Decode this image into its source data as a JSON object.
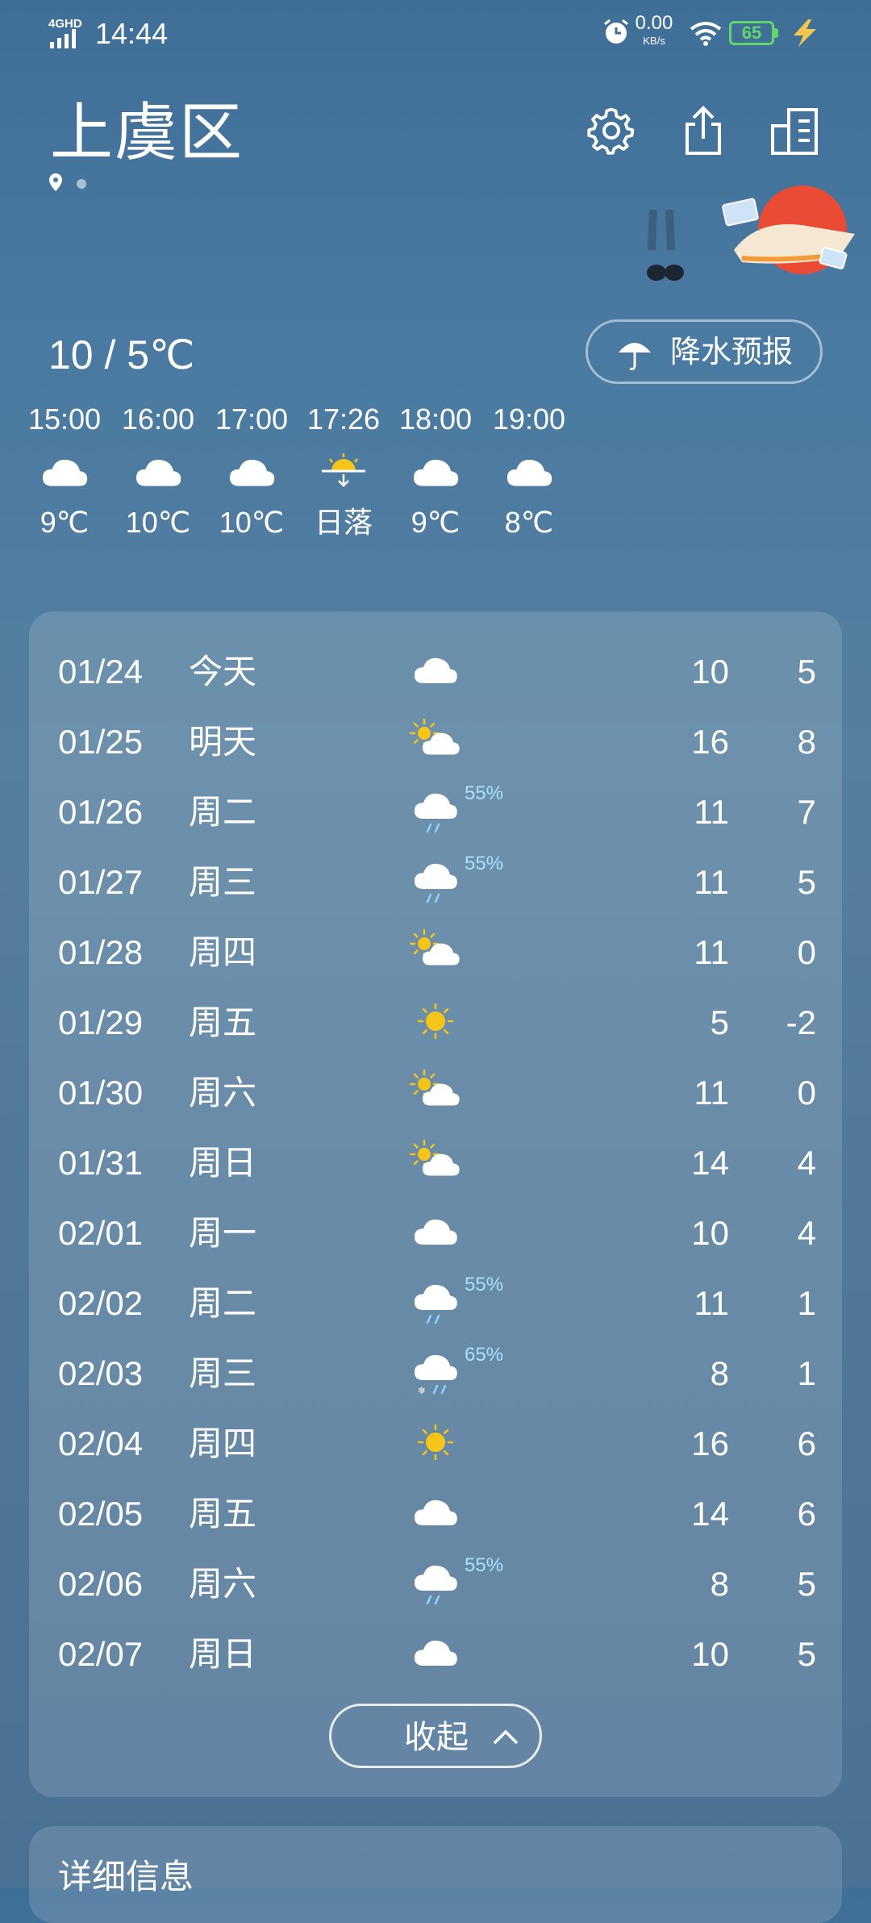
{
  "status_bar": {
    "network": "4GHD",
    "time": "14:44",
    "speed_value": "0.00",
    "speed_unit": "KB/s",
    "battery": "65",
    "battery_color": "#61d66b",
    "charging_color": "#f2c94c"
  },
  "header": {
    "city": "上虞区",
    "actions": [
      "settings-icon",
      "share-icon",
      "city-manage-icon"
    ]
  },
  "today": {
    "range": "10 / 5℃",
    "precip_button": "降水预报"
  },
  "hourly": [
    {
      "time": "15:00",
      "icon": "cloudy-icon",
      "temp": "9℃"
    },
    {
      "time": "16:00",
      "icon": "cloudy-icon",
      "temp": "10℃"
    },
    {
      "time": "17:00",
      "icon": "cloudy-icon",
      "temp": "10℃"
    },
    {
      "time": "17:26",
      "icon": "sunset-icon",
      "temp": "日落"
    },
    {
      "time": "18:00",
      "icon": "cloudy-icon",
      "temp": "9℃"
    },
    {
      "time": "19:00",
      "icon": "cloudy-icon",
      "temp": "8℃"
    }
  ],
  "daily": [
    {
      "date": "01/24",
      "weekday": "今天",
      "icon": "cloudy",
      "precip": "",
      "high": "10",
      "low": "5"
    },
    {
      "date": "01/25",
      "weekday": "明天",
      "icon": "partly-cloudy",
      "precip": "",
      "high": "16",
      "low": "8"
    },
    {
      "date": "01/26",
      "weekday": "周二",
      "icon": "rain",
      "precip": "55%",
      "high": "11",
      "low": "7"
    },
    {
      "date": "01/27",
      "weekday": "周三",
      "icon": "rain",
      "precip": "55%",
      "high": "11",
      "low": "5"
    },
    {
      "date": "01/28",
      "weekday": "周四",
      "icon": "partly-cloudy",
      "precip": "",
      "high": "11",
      "low": "0"
    },
    {
      "date": "01/29",
      "weekday": "周五",
      "icon": "sunny",
      "precip": "",
      "high": "5",
      "low": "-2"
    },
    {
      "date": "01/30",
      "weekday": "周六",
      "icon": "partly-cloudy",
      "precip": "",
      "high": "11",
      "low": "0"
    },
    {
      "date": "01/31",
      "weekday": "周日",
      "icon": "partly-cloudy",
      "precip": "",
      "high": "14",
      "low": "4"
    },
    {
      "date": "02/01",
      "weekday": "周一",
      "icon": "cloudy",
      "precip": "",
      "high": "10",
      "low": "4"
    },
    {
      "date": "02/02",
      "weekday": "周二",
      "icon": "rain",
      "precip": "55%",
      "high": "11",
      "low": "1"
    },
    {
      "date": "02/03",
      "weekday": "周三",
      "icon": "sleet",
      "precip": "65%",
      "high": "8",
      "low": "1"
    },
    {
      "date": "02/04",
      "weekday": "周四",
      "icon": "sunny",
      "precip": "",
      "high": "16",
      "low": "6"
    },
    {
      "date": "02/05",
      "weekday": "周五",
      "icon": "cloudy",
      "precip": "",
      "high": "14",
      "low": "6"
    },
    {
      "date": "02/06",
      "weekday": "周六",
      "icon": "rain",
      "precip": "55%",
      "high": "8",
      "low": "5"
    },
    {
      "date": "02/07",
      "weekday": "周日",
      "icon": "cloudy",
      "precip": "",
      "high": "10",
      "low": "5"
    }
  ],
  "collapse_label": "收起",
  "detail_title": "详细信息",
  "colors": {
    "sun": "#f5c518",
    "rain": "#8fd3ff",
    "precip_text": "#a9e2ff"
  }
}
